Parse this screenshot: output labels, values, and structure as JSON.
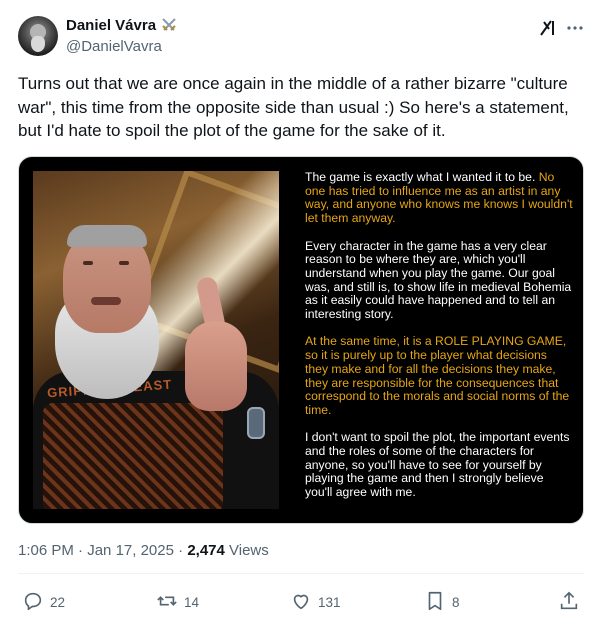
{
  "author": {
    "display_name": "Daniel Vávra",
    "handle": "@DanielVavra",
    "badge_icon": "crossed-swords-icon"
  },
  "tweet": {
    "text": "Turns out that we are once again in the middle of a rather bizarre \"culture war\", this time from the opposite side than usual :) So here's a statement, but I'd hate to spoil the plot of the game for the sake of it."
  },
  "media": {
    "statement": {
      "p1_white": "The game is exactly what I wanted it to be.",
      "p1_yellow": "No one has tried to influence me as an artist in any way, and anyone who knows me knows I wouldn't let them anyway.",
      "p2_white": "Every character in the game has a very clear reason to be where they are, which you'll understand when you play the game. Our goal was, and still is, to show life in medieval Bohemia as it easily could have happened and to tell an interesting story.",
      "p3_yellow": "At the same time, it is a ROLE PLAYING GAME, so it is purely up to the player what decisions they make and for all the decisions they make, they are responsible for the consequences that correspond to the morals and social norms of the time.",
      "p4_white": "I don't want to spoil the plot, the important events and the roles of some of the characters for anyone, so you'll have to see for yourself by playing the game and then I strongly believe you'll agree with me."
    },
    "shirt_text": "GRIPPING BEAST"
  },
  "meta": {
    "time": "1:06 PM",
    "separator1": " · ",
    "date": "Jan 17, 2025",
    "separator2": " · ",
    "views_count": "2,474",
    "views_label": " Views"
  },
  "actions": {
    "replies": "22",
    "reposts": "14",
    "likes": "131",
    "bookmarks": "8"
  },
  "colors": {
    "accent_yellow": "#e6a614",
    "text_primary": "#0f1419",
    "text_secondary": "#536471"
  }
}
